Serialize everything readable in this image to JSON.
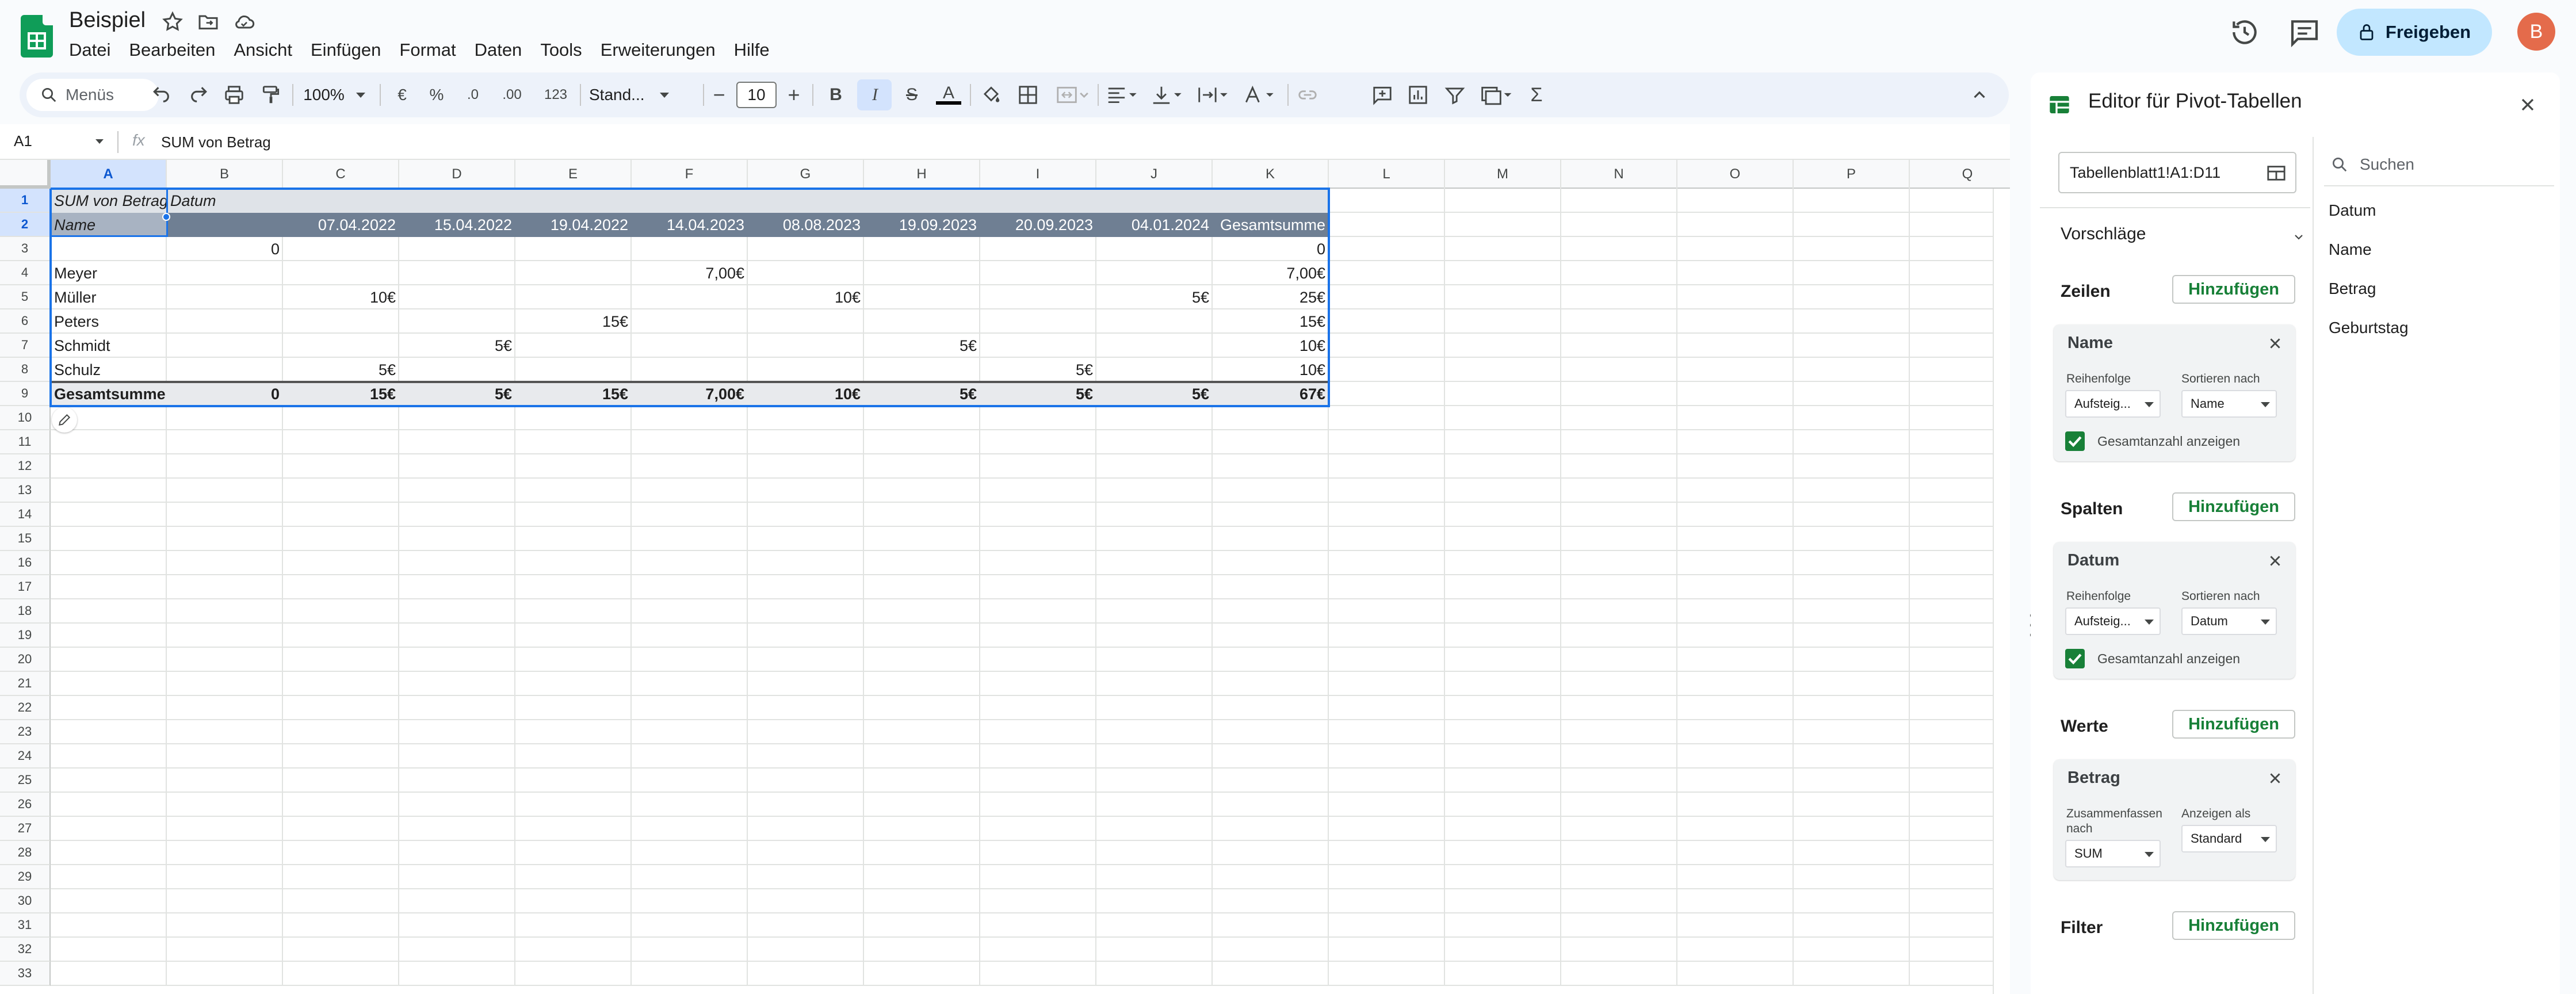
{
  "doc": {
    "title": "Beispiel"
  },
  "menu": [
    "Datei",
    "Bearbeiten",
    "Ansicht",
    "Einfügen",
    "Format",
    "Daten",
    "Tools",
    "Erweiterungen",
    "Hilfe"
  ],
  "header": {
    "share_label": "Freigeben",
    "avatar_letter": "B"
  },
  "toolbar": {
    "search_placeholder": "Menüs",
    "zoom": "100%",
    "currency": "€",
    "percent": "%",
    "dec_decrease": ".0",
    "dec_increase": ".00",
    "number_format": "123",
    "font": "Stand...",
    "font_size": "10"
  },
  "formula": {
    "cell_ref": "A1",
    "content": "SUM von Betrag"
  },
  "grid": {
    "columns": [
      "A",
      "B",
      "C",
      "D",
      "E",
      "F",
      "G",
      "H",
      "I",
      "J",
      "K",
      "L",
      "M",
      "N",
      "O",
      "P",
      "Q"
    ],
    "rows": [
      "1",
      "2",
      "3",
      "4",
      "5",
      "6",
      "7",
      "8",
      "9",
      "10",
      "11",
      "12",
      "13",
      "14",
      "15",
      "16",
      "17",
      "18",
      "19",
      "20",
      "21",
      "22",
      "23",
      "24",
      "25",
      "26",
      "27",
      "28",
      "29",
      "30",
      "31",
      "32",
      "33"
    ],
    "pivot": {
      "r1": [
        "SUM von Betrag",
        "Datum"
      ],
      "r2_label": "Name",
      "dates": [
        "07.04.2022",
        "15.04.2022",
        "19.04.2022",
        "14.04.2023",
        "08.08.2023",
        "19.09.2023",
        "20.09.2023",
        "04.01.2024",
        "Gesamtsumme"
      ],
      "body": [
        [
          "",
          "0",
          "",
          "",
          "",
          "",
          "",
          "",
          "",
          "",
          "0"
        ],
        [
          "Meyer",
          "",
          "",
          "",
          "",
          "7,00€",
          "",
          "",
          "",
          "",
          "7,00€"
        ],
        [
          "Müller",
          "",
          "10€",
          "",
          "",
          "",
          "10€",
          "",
          "",
          "5€",
          "25€"
        ],
        [
          "Peters",
          "",
          "",
          "",
          "15€",
          "",
          "",
          "",
          "",
          "",
          "15€"
        ],
        [
          "Schmidt",
          "",
          "",
          "5€",
          "",
          "",
          "",
          "5€",
          "",
          "",
          "10€"
        ],
        [
          "Schulz",
          "",
          "5€",
          "",
          "",
          "",
          "",
          "",
          "5€",
          "",
          "10€"
        ]
      ],
      "total": [
        "Gesamtsumme",
        "0",
        "15€",
        "5€",
        "15€",
        "7,00€",
        "10€",
        "5€",
        "5€",
        "5€",
        "67€"
      ]
    }
  },
  "panel": {
    "title": "Editor für Pivot-Tabellen",
    "range": "Tabellenblatt1!A1:D11",
    "search_placeholder": "Suchen",
    "fields": [
      "Datum",
      "Name",
      "Betrag",
      "Geburtstag"
    ],
    "suggestions_label": "Vorschläge",
    "add_label": "Hinzufügen",
    "rows": {
      "label": "Zeilen",
      "card_title": "Name",
      "order_label": "Reihenfolge",
      "order_value": "Aufsteig...",
      "sort_label": "Sortieren nach",
      "sort_value": "Name",
      "show_totals": "Gesamtanzahl anzeigen"
    },
    "columns": {
      "label": "Spalten",
      "card_title": "Datum",
      "order_label": "Reihenfolge",
      "order_value": "Aufsteig...",
      "sort_label": "Sortieren nach",
      "sort_value": "Datum",
      "show_totals": "Gesamtanzahl anzeigen"
    },
    "values": {
      "label": "Werte",
      "card_title": "Betrag",
      "summarize_label": "Zusammenfassen nach",
      "summarize_value": "SUM",
      "show_as_label": "Anzeigen als",
      "show_as_value": "Standard"
    },
    "filter": {
      "label": "Filter"
    }
  },
  "colors": {
    "accent": "#1a73e8",
    "share_bg": "#c2e7ff",
    "green": "#188038",
    "pivot_header": "#6f7f93"
  }
}
